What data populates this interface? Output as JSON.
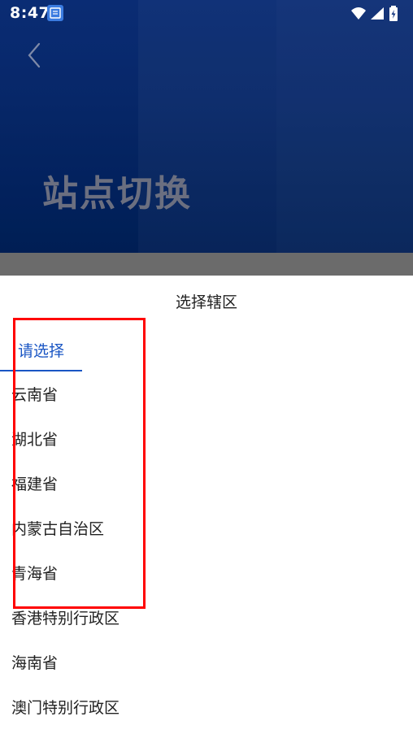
{
  "status_bar": {
    "time": "8:47",
    "icons": [
      "notification-app-icon",
      "wifi-icon",
      "cellular-signal-icon",
      "battery-charging-icon"
    ]
  },
  "header": {
    "back_icon": "chevron-left-icon",
    "title": "站点切换",
    "colors": {
      "background": "#0b2f7c",
      "title": "#6b6f80"
    }
  },
  "sheet": {
    "title": "选择辖区",
    "tab": {
      "label": "请选择",
      "active_color": "#1a56c4"
    },
    "regions": [
      "云南省",
      "湖北省",
      "福建省",
      "内蒙古自治区",
      "青海省",
      "香港特别行政区",
      "海南省",
      "澳门特别行政区"
    ]
  },
  "annotation": {
    "highlight_color": "#ff0000"
  }
}
